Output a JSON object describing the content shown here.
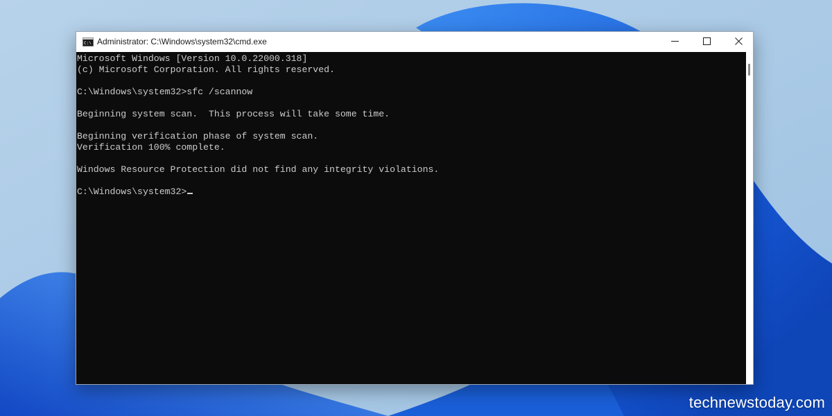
{
  "window": {
    "title": "Administrator: C:\\Windows\\system32\\cmd.exe",
    "icon": "cmd-icon",
    "controls": [
      "minimize-icon",
      "maximize-icon",
      "close-icon"
    ]
  },
  "console": {
    "lines": [
      "Microsoft Windows [Version 10.0.22000.318]",
      "(c) Microsoft Corporation. All rights reserved.",
      "",
      "C:\\Windows\\system32>sfc /scannow",
      "",
      "Beginning system scan.  This process will take some time.",
      "",
      "Beginning verification phase of system scan.",
      "Verification 100% complete.",
      "",
      "Windows Resource Protection did not find any integrity violations.",
      "",
      "C:\\Windows\\system32>"
    ]
  },
  "watermark": "technewstoday.com",
  "colors": {
    "console_bg": "#0c0c0c",
    "console_text": "#cccccc",
    "titlebar_bg": "#ffffff",
    "wallpaper_bg": "#a9c9e4",
    "wallpaper_bloom": "#1f6fe0"
  }
}
